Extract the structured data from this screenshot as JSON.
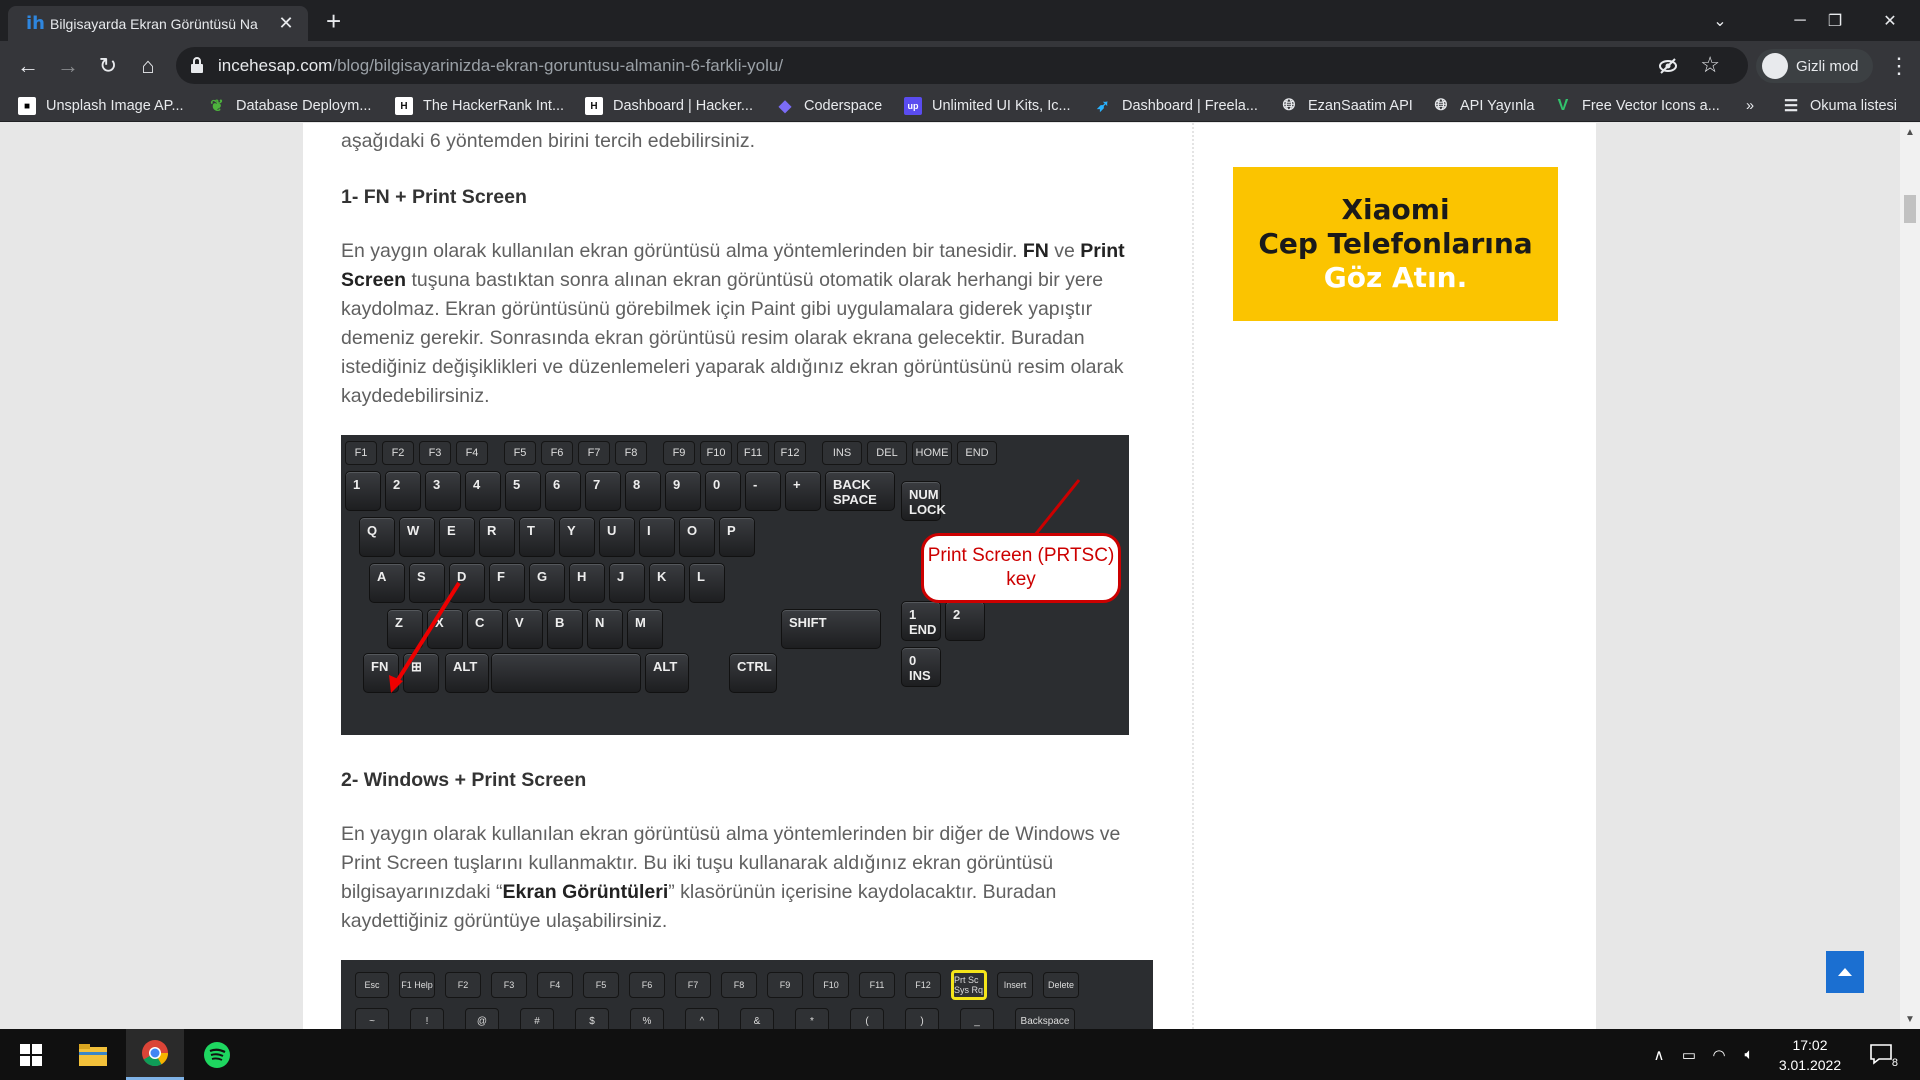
{
  "browser": {
    "tab_title": "Bilgisayarda Ekran Görüntüsü Na",
    "tab_favicon": "ih",
    "url_host": "incehesap.com",
    "url_path": "/blog/bilgisayarinizda-ekran-goruntusu-almanin-6-farkli-yolu/",
    "incognito_label": "Gizli mod",
    "bookmarks": [
      {
        "label": "Unsplash Image AP...",
        "icon": "unsplash-icon",
        "color": "#ffffff"
      },
      {
        "label": "Database Deploym...",
        "icon": "mongodb-leaf-icon",
        "color": "#4db33d"
      },
      {
        "label": "The HackerRank Int...",
        "icon": "hackerrank-icon",
        "color": "#2ec866"
      },
      {
        "label": "Dashboard | Hacker...",
        "icon": "hackerrank-icon",
        "color": "#2ec866"
      },
      {
        "label": "Coderspace",
        "icon": "coderspace-icon",
        "color": "#6c5ce7"
      },
      {
        "label": "Unlimited UI Kits, Ic...",
        "icon": "up-icon",
        "color": "#5a4cf0"
      },
      {
        "label": "Dashboard | Freela...",
        "icon": "freelancer-icon",
        "color": "#29b2fe"
      },
      {
        "label": "EzanSaatim API",
        "icon": "globe-icon",
        "color": "#e8eaed"
      },
      {
        "label": "API Yayınla",
        "icon": "globe-icon",
        "color": "#e8eaed"
      },
      {
        "label": "Free Vector Icons a...",
        "icon": "vecteezy-icon",
        "color": "#32c36c"
      }
    ],
    "bookmarks_overflow": "»",
    "reading_list": "Okuma listesi"
  },
  "article": {
    "intro": "aşağıdaki 6 yöntemden birini tercih edebilirsiniz.",
    "h1": "1- FN + Print Screen",
    "p1_a": "En yaygın olarak kullanılan ekran görüntüsü alma yöntemlerinden bir tanesidir. ",
    "p1_b1": "FN",
    "p1_c": " ve ",
    "p1_b2": "Print Screen",
    "p1_d": " tuşuna bastıktan sonra alınan ekran görüntüsü otomatik olarak herhangi bir yere kaydolmaz. Ekran görüntüsünü görebilmek için Paint gibi uygulamalara giderek yapıştır demeniz gerekir. Sonrasında ekran görüntüsü resim olarak ekrana gelecektir. Buradan istediğiniz değişiklikleri ve düzenlemeleri yaparak aldığınız ekran görüntüsünü resim olarak kaydedebilirsiniz.",
    "callout_l1": "Print Screen (PRTSC)",
    "callout_l2": "key",
    "h2": "2- Windows + Print Screen",
    "p2_a": "En yaygın olarak kullanılan ekran görüntüsü alma yöntemlerinden bir diğer de Windows ve Print Screen tuşlarını kullanmaktır. Bu iki tuşu kullanarak aldığınız ekran görüntüsü bilgisayarınızdaki “",
    "p2_b": "Ekran Görüntüleri",
    "p2_c": "” klasörünün içerisine kaydolacaktır. Buradan kaydettiğiniz görüntüye ulaşabilirsiniz."
  },
  "keyboard1": {
    "fn_row": [
      "F1",
      "F2",
      "F3",
      "F4",
      "F5",
      "F6",
      "F7",
      "F8",
      "F9",
      "F10",
      "F11",
      "F12",
      "INS",
      "DEL",
      "HOME",
      "END"
    ],
    "num_row": [
      "1",
      "2",
      "3",
      "4",
      "5",
      "6",
      "7",
      "8",
      "9",
      "0",
      "-",
      "+",
      "BACK SPACE"
    ],
    "q_row": [
      "Q",
      "W",
      "E",
      "R",
      "T",
      "Y",
      "U",
      "I",
      "O",
      "P"
    ],
    "a_row": [
      "A",
      "S",
      "D",
      "F",
      "G",
      "H",
      "J",
      "K",
      "L"
    ],
    "z_row": [
      "Z",
      "X",
      "C",
      "V",
      "B",
      "N",
      "M"
    ],
    "shift": "SHIFT",
    "bottom": [
      "FN",
      "ALT",
      "ALT",
      "CTRL"
    ],
    "numpad": [
      "NUM LOCK",
      "1 END",
      "2",
      "0 INS"
    ]
  },
  "keyboard2": {
    "top_row": [
      "Esc",
      "F1 Help",
      "F2",
      "F3",
      "F4",
      "F5",
      "F6",
      "F7",
      "F8",
      "F9",
      "F10",
      "F11",
      "F12",
      "Prt Sc Sys Rq",
      "Insert",
      "Delete"
    ],
    "num_row": [
      "~",
      "!",
      "@",
      "#",
      "$",
      "%",
      "^",
      "&",
      "*",
      "(",
      ")",
      "_",
      "Backspace"
    ]
  },
  "ad": {
    "line1": "Xiaomi",
    "line2": "Cep Telefonlarına",
    "line3": "Göz Atın.",
    "bg": "#fbc400"
  },
  "taskbar": {
    "time": "17:02",
    "date": "3.01.2022",
    "notif_count": "8"
  }
}
